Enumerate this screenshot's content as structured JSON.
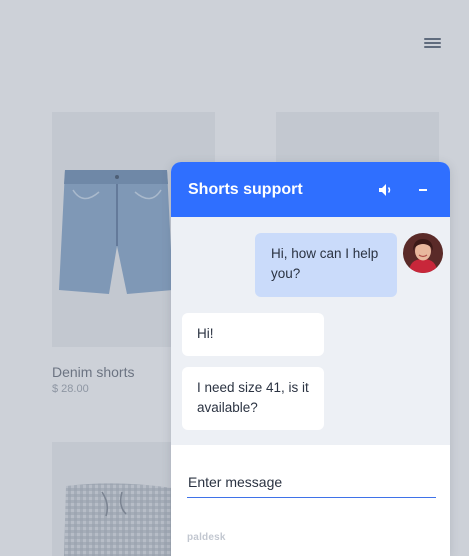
{
  "products": [
    {
      "name": "Denim shorts",
      "price": "$ 28.00"
    }
  ],
  "chat": {
    "title": "Shorts support",
    "messages": [
      {
        "from": "agent",
        "text": "Hi, how can I help you?"
      },
      {
        "from": "user",
        "text": "Hi!"
      },
      {
        "from": "user",
        "text": "I need size 41, is it available?"
      }
    ],
    "input_placeholder": "Enter message",
    "brand": "paldesk"
  },
  "colors": {
    "accent": "#2f6fff",
    "agent_bubble": "#cadbfa",
    "page_bg": "#cdd1d8"
  },
  "icons": [
    "menu-icon",
    "sound-icon",
    "minimize-icon"
  ]
}
